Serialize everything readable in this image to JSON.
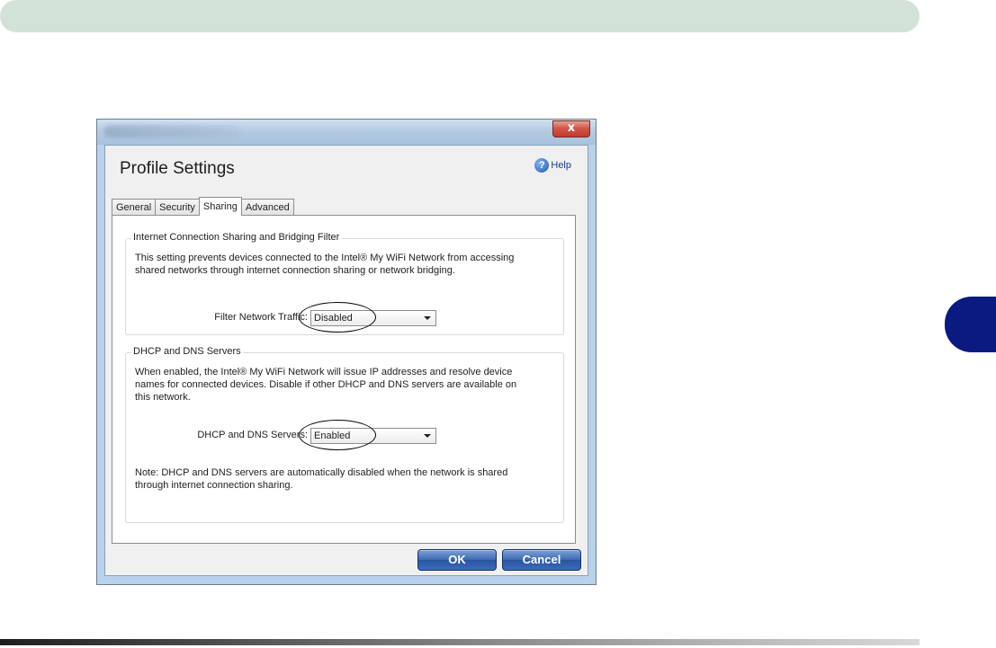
{
  "dialog": {
    "title": "Profile Settings",
    "close_label": "x",
    "help_label": "Help",
    "help_glyph": "?"
  },
  "tabs": [
    {
      "label": "General"
    },
    {
      "label": "Security"
    },
    {
      "label": "Sharing",
      "active": true
    },
    {
      "label": "Advanced"
    }
  ],
  "sharing": {
    "filter_group": {
      "legend": "Internet Connection Sharing and Bridging Filter",
      "description_line1": "This setting prevents devices connected to the Intel® My WiFi Network from accessing",
      "description_line2": "shared networks through internet connection sharing or network bridging.",
      "field_label": "Filter Network Traffic:",
      "field_value": "Disabled"
    },
    "dhcp_group": {
      "legend": "DHCP and DNS Servers",
      "description_line1": "When enabled, the Intel® My WiFi Network will issue IP addresses and resolve device",
      "description_line2": "names for connected devices.  Disable if other DHCP and DNS servers are available on",
      "description_line3": "this network.",
      "field_label": "DHCP and DNS Servers:",
      "field_value": "Enabled",
      "note_line1": "Note: DHCP and DNS servers are automatically disabled when the network is shared",
      "note_line2": "through internet connection sharing."
    }
  },
  "buttons": {
    "ok": "OK",
    "cancel": "Cancel"
  },
  "colors": {
    "page_band": "#d3e2d7",
    "chapter_tab": "#0b1a80",
    "button_blue": "#3d68b2"
  }
}
